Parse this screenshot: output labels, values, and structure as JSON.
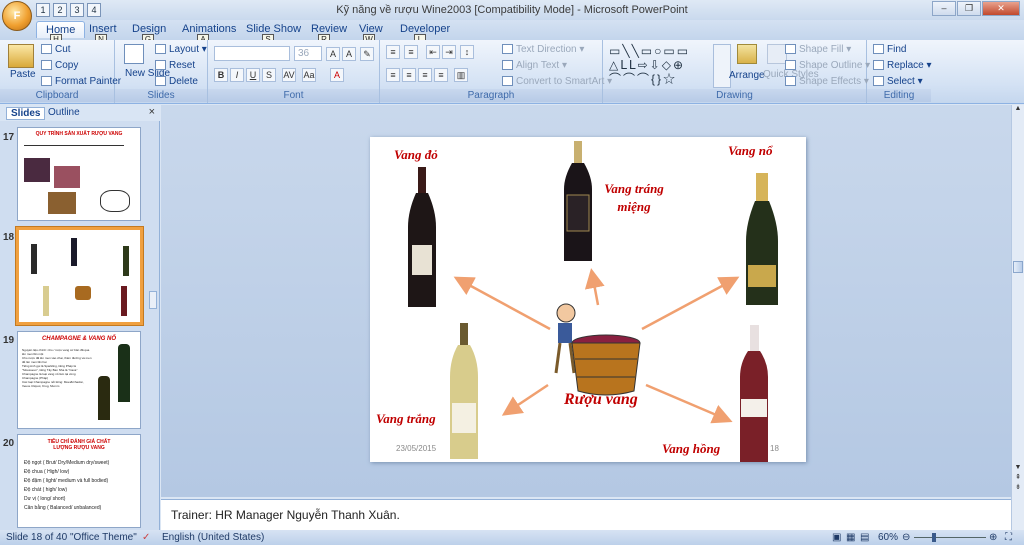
{
  "window": {
    "title": "Kỹ năng về rượu  Wine2003 [Compatibility Mode] - Microsoft PowerPoint",
    "office_key": "F"
  },
  "qat": [
    "1",
    "2",
    "3",
    "4"
  ],
  "tabs": [
    {
      "label": "Home",
      "key": "H"
    },
    {
      "label": "Insert",
      "key": "N"
    },
    {
      "label": "Design",
      "key": "G"
    },
    {
      "label": "Animations",
      "key": "A"
    },
    {
      "label": "Slide Show",
      "key": "S"
    },
    {
      "label": "Review",
      "key": "R"
    },
    {
      "label": "View",
      "key": "W"
    },
    {
      "label": "Developer",
      "key": "L"
    }
  ],
  "ribbon": {
    "clipboard": {
      "label": "Clipboard",
      "paste": "Paste",
      "cut": "Cut",
      "copy": "Copy",
      "format_painter": "Format Painter"
    },
    "slides": {
      "label": "Slides",
      "new_slide": "New Slide",
      "layout": "Layout",
      "reset": "Reset",
      "delete": "Delete"
    },
    "font": {
      "label": "Font",
      "size": "36"
    },
    "paragraph": {
      "label": "Paragraph",
      "text_direction": "Text Direction",
      "align_text": "Align Text",
      "convert": "Convert to SmartArt"
    },
    "drawing": {
      "label": "Drawing",
      "arrange": "Arrange",
      "quick_styles": "Quick Styles",
      "shape_fill": "Shape Fill",
      "shape_outline": "Shape Outline",
      "shape_effects": "Shape Effects"
    },
    "editing": {
      "label": "Editing",
      "find": "Find",
      "replace": "Replace",
      "select": "Select"
    }
  },
  "panel": {
    "tab_slides": "Slides",
    "tab_outline": "Outline"
  },
  "thumbnails": [
    {
      "num": "17",
      "title": "QUY TRÌNH SẢN XUẤT RƯỢU VANG"
    },
    {
      "num": "18",
      "selected": true
    },
    {
      "num": "19",
      "title": "CHAMPAGNE & VANG NỔ",
      "lines": [
        "Nguyên liệu chính: nho / rượu vang cơ bản đã qua lên men lần một",
        "Cho rượu đã lên men vào chai, thêm đường và men để lên men lần hai",
        "Tiếng Anh gọi là Sparkling, tiếng Pháp là \"Mousseux\", tiếng Tây Ban Nha là \"Cava\"",
        "Champagne là loại vang nổ làm tại vùng Champagne (Pháp)",
        "Các loại Champagne nổi tiếng: Moet&Chadon, Veuve Cliquot, Krug, Mumm"
      ]
    },
    {
      "num": "20",
      "title": "TIÊU CHÍ ĐÁNH GIÁ CHẤT LƯỢNG RƯỢU VANG",
      "lines": [
        "Độ ngọt ( Brut/ Dry/Medium dry/sweet)",
        "Độ chua ( High/ low)",
        "Độ đậm ( light/ medium và full bodied)",
        "Độ chát ( high/ low)",
        "Dư vị ( long/ short)",
        "Cân bằng ( Balanced/  unbalanced)"
      ]
    }
  ],
  "slide": {
    "labels": {
      "red": "Vang đỏ",
      "dessert": "Vang tráng miệng",
      "sparkling": "Vang nổ",
      "white": "Vang trắng",
      "rose": "Vang hồng",
      "center": "Rượu vang"
    },
    "date": "23/05/2015",
    "page_fragment": "18"
  },
  "notes": "Trainer: HR Manager  Nguyễn  Thanh  Xuân.",
  "status": {
    "slide": "Slide 18 of 40",
    "theme": "\"Office Theme\"",
    "language": "English (United States)",
    "zoom": "60%"
  }
}
